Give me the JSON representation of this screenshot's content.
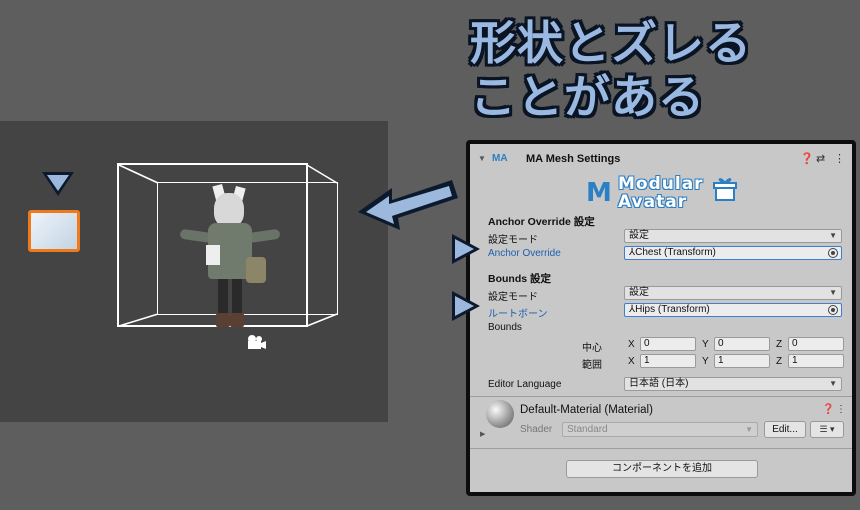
{
  "caption": {
    "line1": "形状とズレる",
    "line2": "ことがある"
  },
  "colors": {
    "accent": "#9ab9e2",
    "outline": "#0b1422",
    "selection": "#f07a1a",
    "link": "#1d5fb0"
  },
  "component": {
    "title": "MA Mesh Settings",
    "icon": "modular-avatar-icon",
    "header_icons": [
      "help-icon",
      "preset-icon",
      "kebab-menu-icon"
    ],
    "logo": {
      "line1": "Modular",
      "line2": "Avatar"
    }
  },
  "anchor": {
    "section": "Anchor Override 設定",
    "mode_label": "設定モード",
    "mode_value": "設定",
    "override_label": "Anchor Override",
    "override_value": "Chest (Transform)"
  },
  "bounds": {
    "section": "Bounds 設定",
    "mode_label": "設定モード",
    "mode_value": "設定",
    "root_label": "ルートボーン",
    "root_value": "Hips (Transform)",
    "bounds_label": "Bounds",
    "center_label": "中心",
    "extent_label": "範囲",
    "axes": [
      "X",
      "Y",
      "Z"
    ],
    "center": [
      "0",
      "0",
      "0"
    ],
    "extent": [
      "1",
      "1",
      "1"
    ]
  },
  "language": {
    "label": "Editor Language",
    "value": "日本語 (日本)"
  },
  "material": {
    "title": "Default-Material (Material)",
    "shader_label": "Shader",
    "shader_value": "Standard",
    "edit_label": "Edit...",
    "list_label": "☰ ▾"
  },
  "add_component_label": "コンポーネントを追加"
}
